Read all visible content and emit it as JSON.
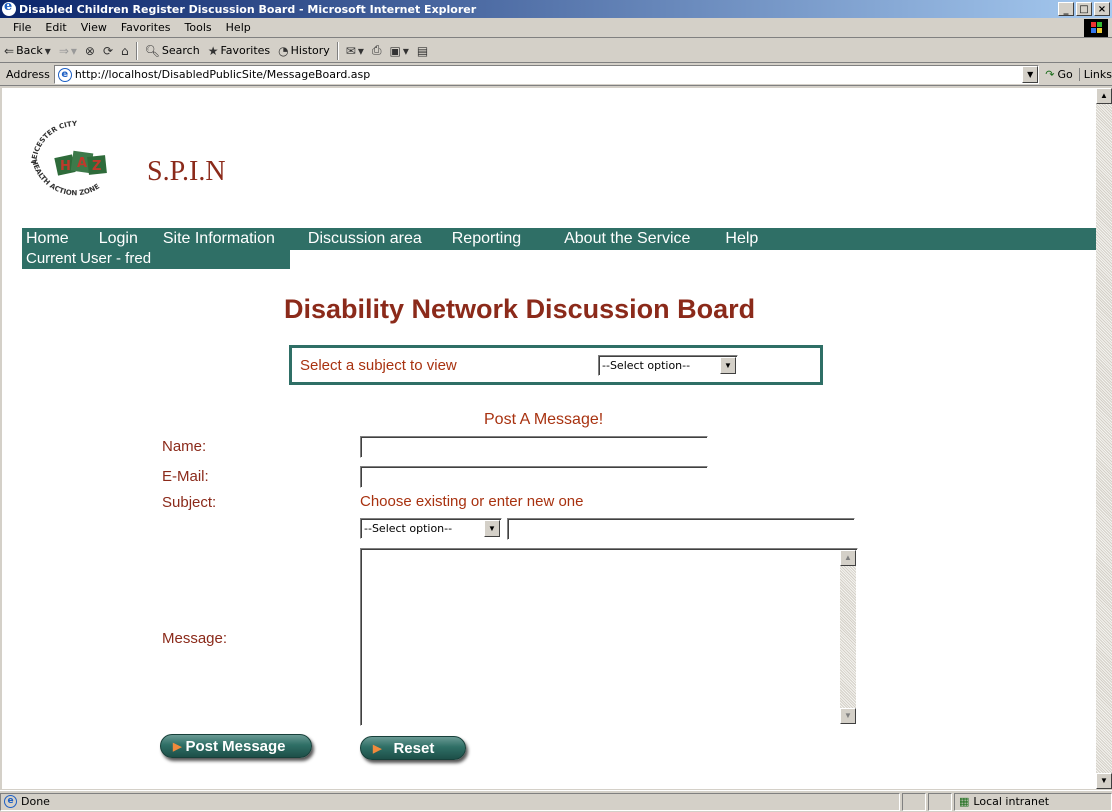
{
  "window": {
    "title": "Disabled Children Register Discussion Board - Microsoft Internet Explorer",
    "controls": [
      "_",
      "□",
      "×"
    ]
  },
  "menubar": {
    "items": [
      "File",
      "Edit",
      "View",
      "Favorites",
      "Tools",
      "Help"
    ]
  },
  "toolbar": {
    "back": "Back",
    "search": "Search",
    "favorites": "Favorites",
    "history": "History"
  },
  "addressbar": {
    "label": "Address",
    "url": "http://localhost/DisabledPublicSite/MessageBoard.asp",
    "go": "Go",
    "links": "Links"
  },
  "site": {
    "brand": "S.P.I.N",
    "logo_text": "LEICESTER CITY HEALTH ACTION ZONE",
    "logo_letters": "HAZ",
    "colors": {
      "nav_bg": "#2f6f66",
      "heading": "#8b2a1a",
      "label": "#a83210"
    }
  },
  "nav": {
    "items": [
      "Home",
      "Login",
      "Site Information",
      "Discussion area",
      "Reporting",
      "About the Service",
      "Help"
    ],
    "current_user": "Current User - fred"
  },
  "page": {
    "heading": "Disability Network Discussion Board",
    "subject_select_label": "Select a subject to view",
    "subject_select_value": "--Select option--",
    "post_title": "Post A Message!"
  },
  "form": {
    "name_label": "Name:",
    "name_value": "",
    "email_label": "E-Mail:",
    "email_value": "",
    "subject_label": "Subject:",
    "subject_hint": "Choose existing or enter new one",
    "subject_select_value": "--Select option--",
    "subject_new_value": "",
    "message_label": "Message:",
    "message_value": "",
    "post_button": "Post Message",
    "reset_button": "Reset"
  },
  "statusbar": {
    "status": "Done",
    "zone": "Local intranet"
  }
}
